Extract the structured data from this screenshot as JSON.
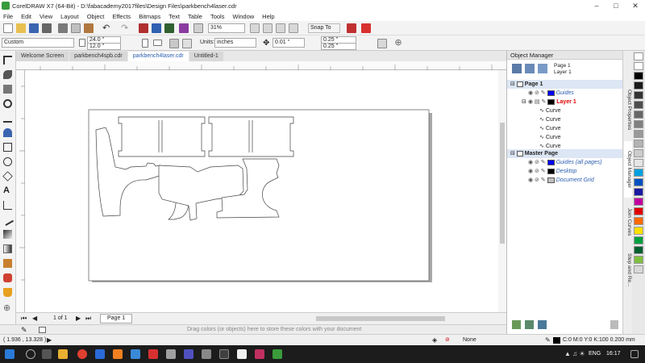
{
  "window": {
    "title": "CorelDRAW X7 (64-Bit) - D:\\fabacademy2017files\\Design Files\\parkbench4laser.cdr"
  },
  "menu": [
    "File",
    "Edit",
    "View",
    "Layout",
    "Object",
    "Effects",
    "Bitmaps",
    "Text",
    "Table",
    "Tools",
    "Window",
    "Help"
  ],
  "toolbar": {
    "zoom": "31%",
    "snap_to": "Snap To"
  },
  "propbar": {
    "preset": "Custom",
    "width": "24.0 \"",
    "height": "12.0 \"",
    "units_label": "Units:",
    "units": "inches",
    "nudge": "0.01 \"",
    "dup_x": "0.25 \"",
    "dup_y": "0.25 \""
  },
  "tabs": [
    "Welcome Screen",
    "parkbench4spb.cdr",
    "parkbench4laser.cdr",
    "Untitled-1"
  ],
  "pager": {
    "count": "1 of 1",
    "page_tab": "Page 1"
  },
  "colorbar": {
    "hint": "Drag colors (or objects) here to store these colors with your document"
  },
  "status": {
    "coords": "( 1.936 , 13.328 )",
    "fill": "None",
    "outline": "C:0 M:0 Y:0 K:100  0.200 mm"
  },
  "taskbar": {
    "lang": "ENG",
    "time": "16:17"
  },
  "docker": {
    "title": "Object Manager",
    "current_page": "Page 1",
    "current_layer": "Layer 1",
    "page": "Page 1",
    "guides": "Guides",
    "layer": "Layer 1",
    "curves": [
      "Curve",
      "Curve",
      "Curve",
      "Curve",
      "Curve"
    ],
    "master": "Master Page",
    "master_guides": "Guides (all pages)",
    "desktop": "Desktop",
    "grid": "Document Grid"
  },
  "side_tabs": [
    "Object Properties",
    "Object Manager",
    "Join Curves",
    "Step and Re..."
  ],
  "colors": {
    "accent_blue": "#2a5db0",
    "layer_red": "#e00000",
    "guide_blue": "#0000ff"
  }
}
